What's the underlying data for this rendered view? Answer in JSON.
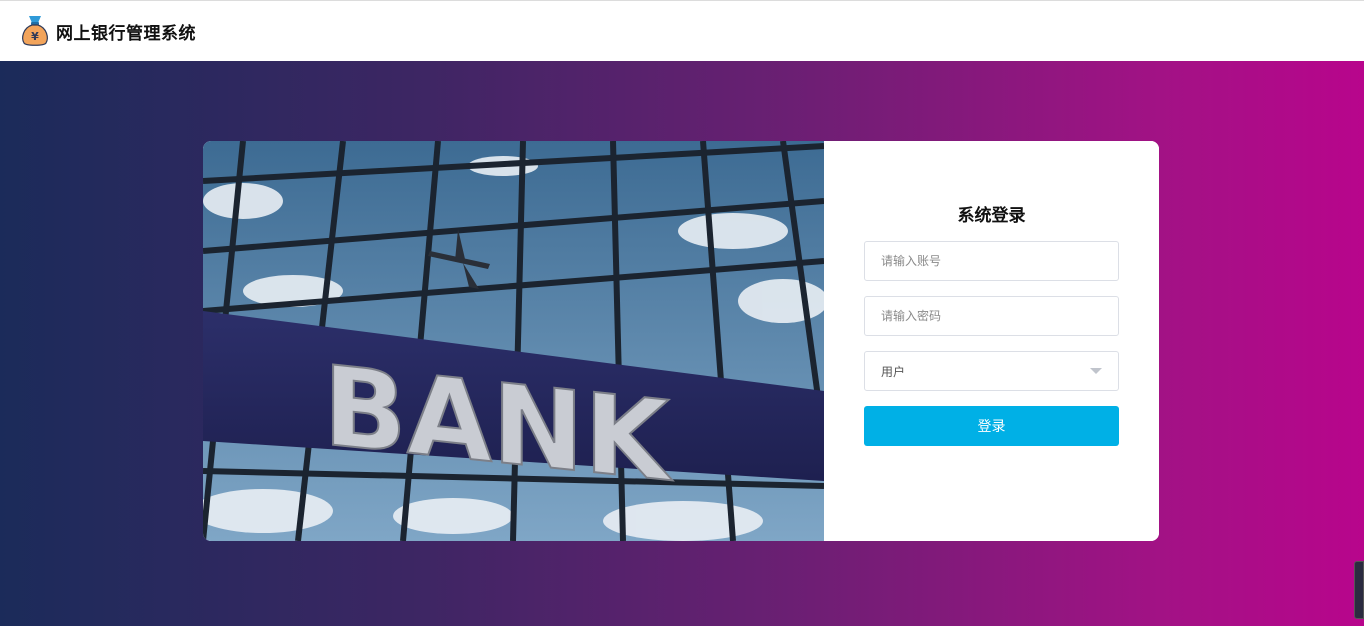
{
  "header": {
    "title": "网上银行管理系统",
    "logo_icon": "money-bag-icon",
    "logo_symbol": "¥"
  },
  "hero": {
    "sign_text": "BANK"
  },
  "login": {
    "title": "系统登录",
    "account_placeholder": "请输入账号",
    "password_placeholder": "请输入密码",
    "role_selected": "用户",
    "submit_label": "登录"
  },
  "colors": {
    "primary_button": "#00b0e6",
    "gradient_start": "#1b2b5a",
    "gradient_end": "#b8058c"
  }
}
